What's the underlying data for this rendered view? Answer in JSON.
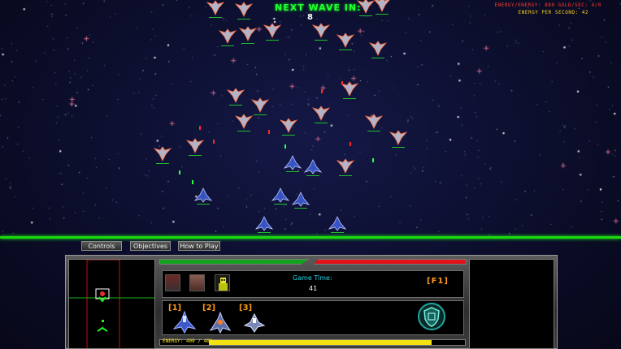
{
  "hud": {
    "wave_label": "NEXT WAVE IN:",
    "wave_countdown": "8",
    "stat_line_1": "ENERGY/ENERGY: 880  GOLD/SEC: 4/0",
    "stat_line_2": "ENERGY PER SECOND:  42"
  },
  "tabs": [
    {
      "label": "Controls"
    },
    {
      "label": "Objectives"
    },
    {
      "label": "How to Play"
    }
  ],
  "panel": {
    "game_time_label": "Game Time:",
    "game_time_value": "41",
    "hotkey_f1": "[F1]",
    "units": [
      {
        "key": "[1]",
        "icon": "fighter-ship-icon"
      },
      {
        "key": "[2]",
        "icon": "cruiser-ship-icon"
      },
      {
        "key": "[3]",
        "icon": "scout-ship-icon"
      }
    ],
    "items": [
      {
        "icon": "cargo-crate-icon"
      },
      {
        "icon": "armor-plate-icon"
      },
      {
        "icon": "yellow-robot-icon"
      }
    ],
    "shield_icon": "shield-icon",
    "energy_label": "ENERGY:  400 / 400",
    "energy_fraction": 0.87,
    "player_health_fraction": 1.0,
    "enemy_health_fraction": 1.0
  },
  "colors": {
    "hud_green": "#22ff33",
    "enemy_red": "#e2111a",
    "player_green": "#13a21e",
    "hotkey_orange": "#ff9a1a",
    "time_cyan": "#20d6e6",
    "energy_yellow": "#f2e20f"
  }
}
